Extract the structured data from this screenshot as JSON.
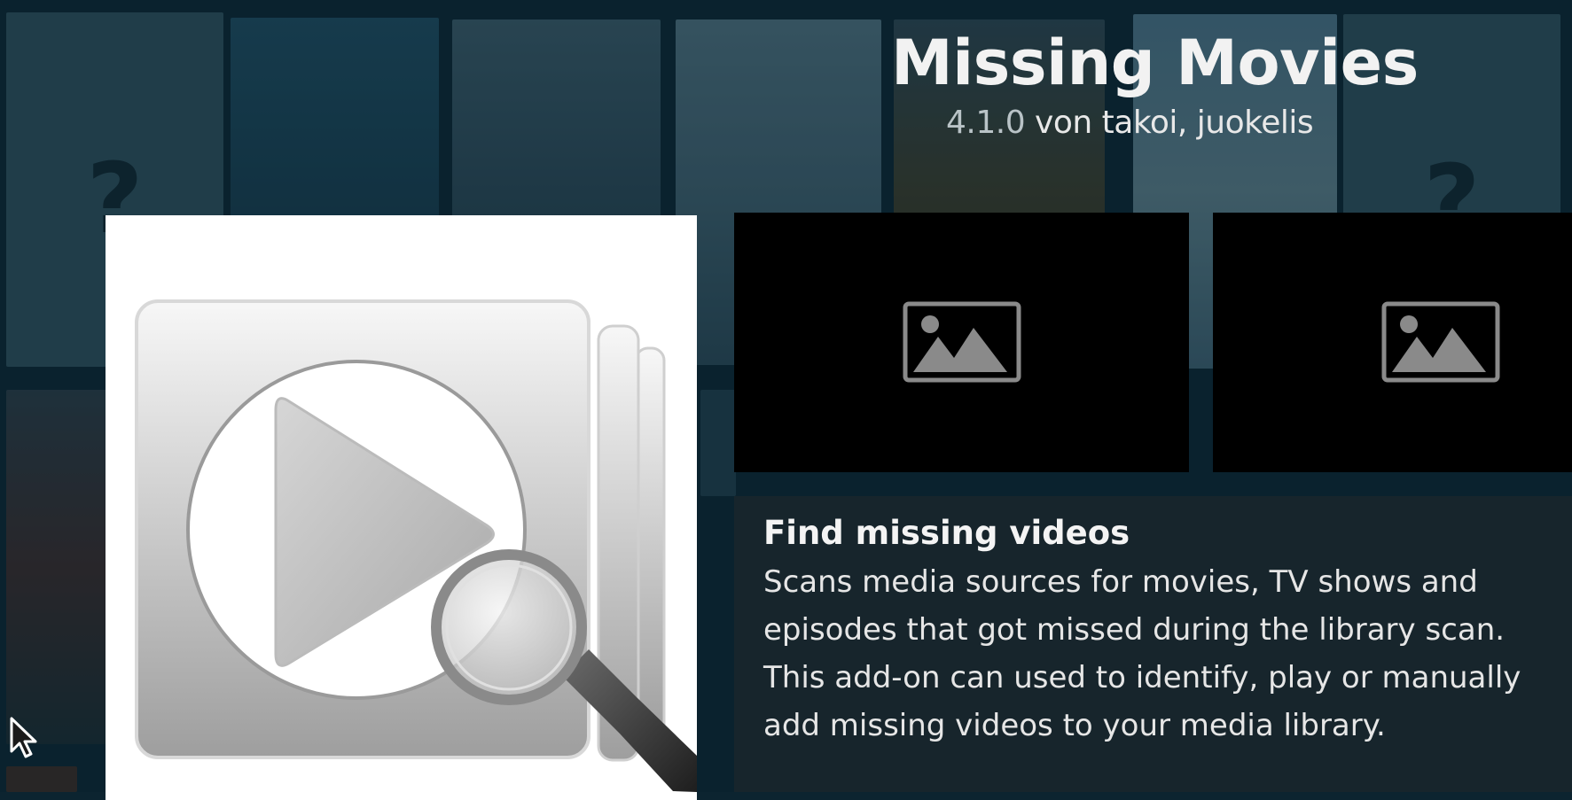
{
  "addon": {
    "title": "Missing Movies",
    "version": "4.1.0",
    "author_line": " von takoi, juokelis"
  },
  "description": {
    "heading": "Find missing videos",
    "body": "Scans media sources for movies, TV shows and episodes that got missed during the library scan. This add-on can used to identify, play or manually add missing videos to your media library."
  },
  "background": {
    "placeholder_glyph": "?"
  },
  "icons": {
    "addon_icon": "play-magnifier-icon",
    "screenshot_placeholder": "image-placeholder-icon",
    "cursor": "mouse-pointer-icon"
  },
  "colors": {
    "background": "#0c2430",
    "panel": "#19262c",
    "title": "#f2f2f2",
    "version": "#b9c3c7"
  }
}
